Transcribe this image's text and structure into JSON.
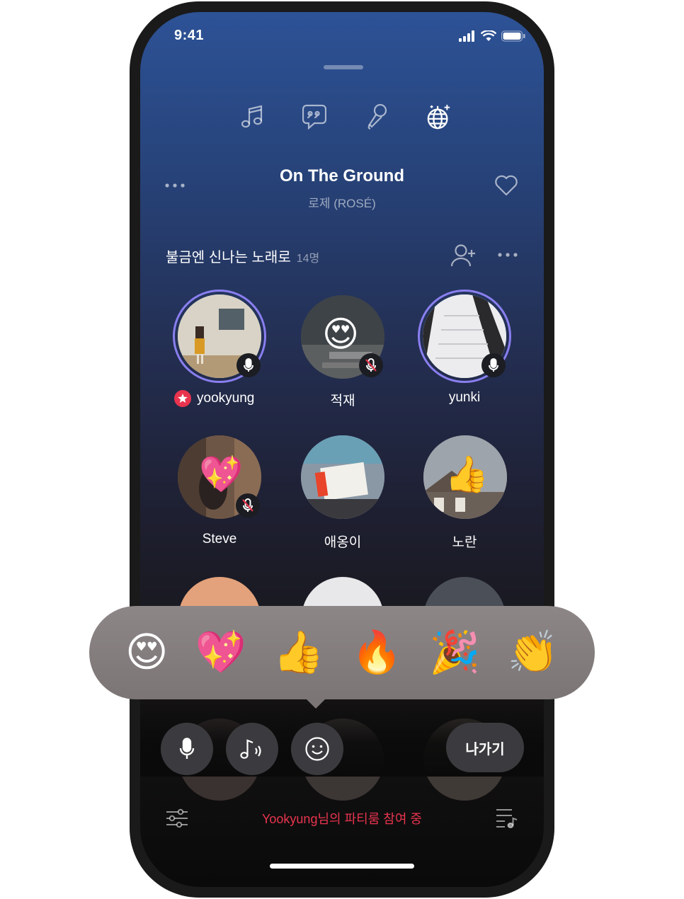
{
  "status_bar": {
    "time": "9:41"
  },
  "mode_tabs": [
    {
      "icon": "music-note-icon"
    },
    {
      "icon": "chat-quote-icon"
    },
    {
      "icon": "microphone-icon"
    },
    {
      "icon": "disco-ball-icon",
      "active": true
    }
  ],
  "song": {
    "title": "On The Ground",
    "artist": "로제 (ROSÉ)"
  },
  "room": {
    "name": "불금엔 신나는 노래로",
    "count": "14명"
  },
  "participants": [
    {
      "name": "yookyung",
      "host": true,
      "mic": "on",
      "ring": true,
      "bg": "#c9c3b5"
    },
    {
      "name": "적재",
      "mic": "muted",
      "reaction": "😍",
      "bg": "#4a4f55"
    },
    {
      "name": "yunki",
      "mic": "on",
      "ring": true,
      "bg": "#e8e8ea"
    },
    {
      "name": "Steve",
      "mic": "muted",
      "reaction": "💖",
      "bg": "#5b4a3f"
    },
    {
      "name": "애옹이",
      "mic": "none",
      "bg": "#7a8a99"
    },
    {
      "name": "노란",
      "mic": "none",
      "reaction": "👍",
      "bg": "#8f8f92"
    }
  ],
  "reactions": [
    "😍",
    "💖",
    "👍",
    "🔥",
    "🎉",
    "👏"
  ],
  "controls": {
    "leave_label": "나가기"
  },
  "footer": {
    "party_status": "Yookyung님의 파티룸 참여 중"
  },
  "colors": {
    "accent_red": "#e8344e",
    "ring": "#8a7ff0",
    "button_bg": "#3b3b3f"
  }
}
